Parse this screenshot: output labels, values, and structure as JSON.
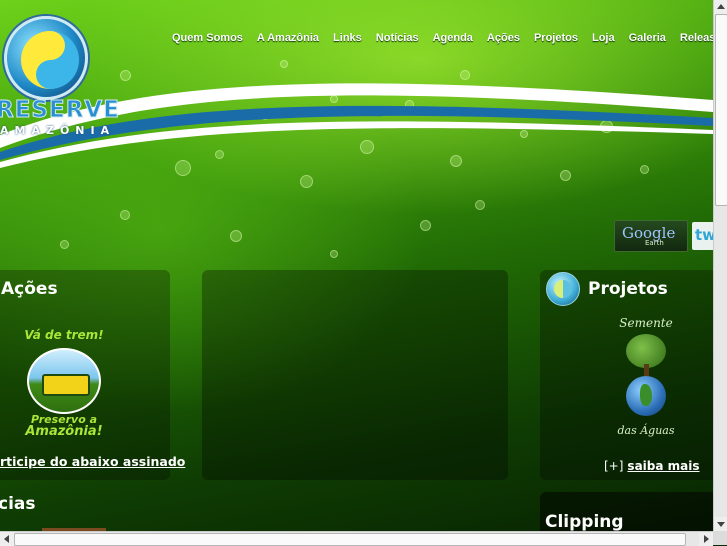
{
  "logo": {
    "text": "RESERVE",
    "subtitle": "AMAZÔNIA"
  },
  "nav": {
    "items": [
      "Quem Somos",
      "A Amazônia",
      "Links",
      "Notícias",
      "Agenda",
      "Ações",
      "Projetos",
      "Loja",
      "Galeria",
      "Releases"
    ]
  },
  "social": {
    "google_earth": {
      "brand": "Google",
      "product": "Earth"
    },
    "twitter": {
      "text": "tw"
    }
  },
  "acoes": {
    "title": "Ações",
    "badge_top": "Vá de trem!",
    "badge_bottom_1": "Preservo a",
    "badge_bottom_2": "Amazônia!",
    "link": "rticipe do abaixo assinado"
  },
  "projetos": {
    "title": "Projetos",
    "badge_top": "Semente",
    "badge_bottom": "das Águas",
    "more_prefix": "[+]",
    "more_link": "saiba mais"
  },
  "noticias": {
    "title": "cias"
  },
  "clipping": {
    "title": "Clipping"
  },
  "colors": {
    "accent_green": "#a9e63a",
    "brand_blue": "#2a8fd0"
  }
}
